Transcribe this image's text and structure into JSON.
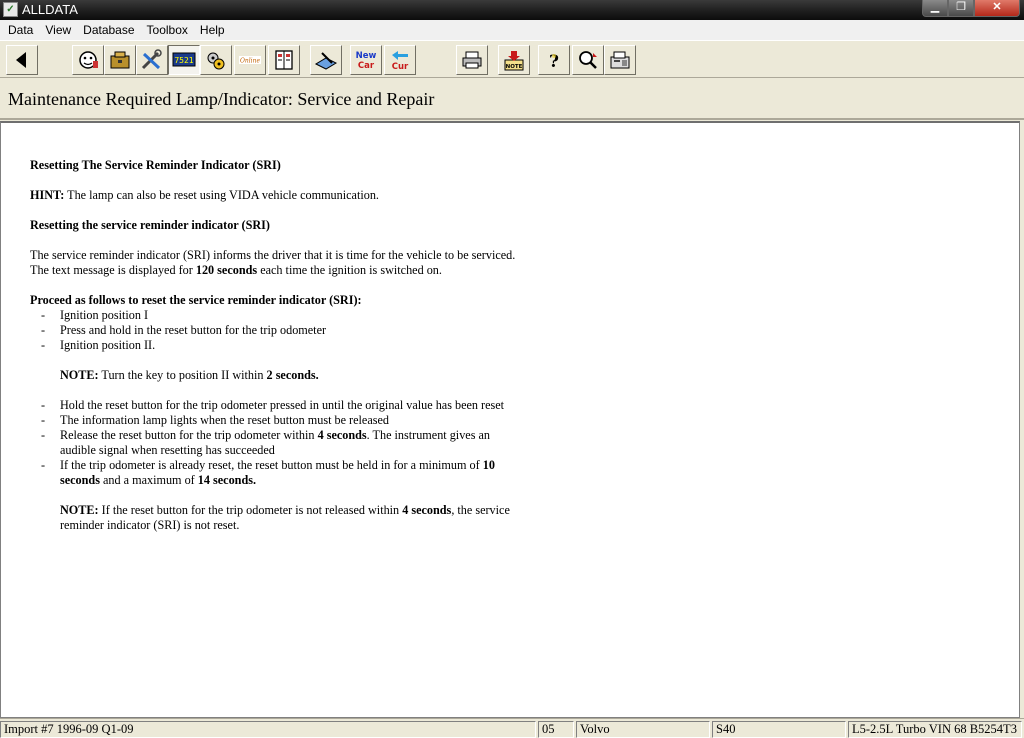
{
  "window": {
    "title": "ALLDATA",
    "app_icon": "alldata-icon"
  },
  "menu": [
    "Data",
    "View",
    "Database",
    "Toolbox",
    "Help"
  ],
  "toolbar": {
    "new_car_label": [
      "New",
      "Car"
    ],
    "old_car_label": [
      "Cur"
    ],
    "note_label": "NOTE",
    "online_label": "Online",
    "component_label": "7521"
  },
  "page": {
    "title": "Maintenance Required Lamp/Indicator:  Service and Repair"
  },
  "doc": {
    "heading1": "Resetting The Service Reminder Indicator (SRI)",
    "hint_label": "HINT:",
    "hint_text": "  The lamp can also be reset using VIDA vehicle communication.",
    "heading2": "Resetting the service reminder indicator (SRI)",
    "intro_a": "The service reminder indicator (SRI) informs the driver that it is time for the vehicle to be serviced. The text message is displayed for ",
    "intro_b": "120 seconds",
    "intro_c": " each time the ignition is switched on.",
    "proceed": "Proceed as follows to reset the service reminder indicator (SRI):",
    "dash": "-",
    "steps1": [
      "Ignition position I",
      "Press and hold in the reset button for the trip odometer",
      "Ignition position II."
    ],
    "note1_label": "NOTE:",
    "note1_a": "  Turn the key to position II within ",
    "note1_b": "2 seconds.",
    "step4": "Hold the reset button for the trip odometer pressed in until the original value has been reset",
    "step5": "The information lamp lights when the reset button must be released",
    "step6_a": "Release the reset button for the trip odometer within ",
    "step6_b": "4 seconds",
    "step6_c": ". The instrument gives an audible signal when resetting has succeeded",
    "step7_a": "If the trip odometer is already reset, the reset button must be held in for a minimum of ",
    "step7_b": "10 seconds",
    "step7_c": " and a maximum of ",
    "step7_d": "14 seconds.",
    "note2_label": "NOTE:",
    "note2_a": "  If the reset button for the trip odometer is not released within ",
    "note2_b": "4 seconds",
    "note2_c": ", the service reminder indicator (SRI) is not reset."
  },
  "status": {
    "import": "Import #7 1996-09 Q1-09",
    "year": "05",
    "make": "Volvo",
    "model": "S40",
    "engine": "L5-2.5L Turbo VIN 68 B5254T3"
  },
  "colors": {
    "titlebar": "#1e1e1e",
    "toolbar": "#ece9d8",
    "doc_bg": "#ffffff",
    "close": "#b4281a"
  }
}
